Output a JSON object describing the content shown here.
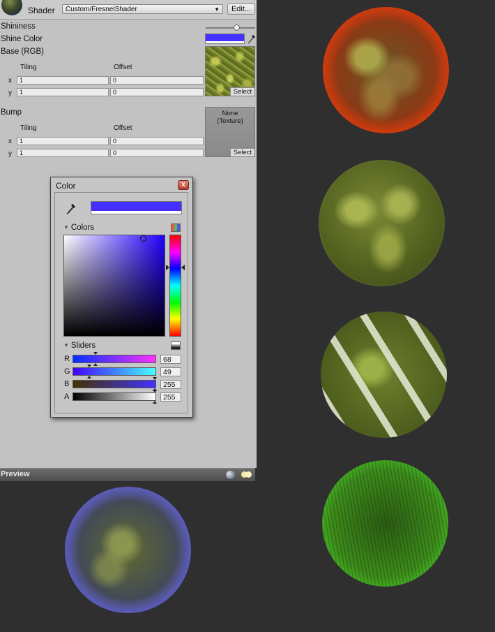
{
  "inspector": {
    "shader_label": "Shader",
    "shader_value": "Custom/FresnelShader",
    "edit_label": "Edit...",
    "props": {
      "shininess": "Shininess",
      "shine_color": "Shine Color",
      "shine_color_hex": "#4431ff",
      "base": "Base (RGB)",
      "bump": "Bump"
    },
    "base": {
      "tiling": "Tiling",
      "offset": "Offset",
      "x_label": "x",
      "y_label": "y",
      "tiling_x": "1",
      "tiling_y": "1",
      "offset_x": "0",
      "offset_y": "0",
      "select": "Select"
    },
    "bump": {
      "tiling": "Tiling",
      "offset": "Offset",
      "x_label": "x",
      "y_label": "y",
      "tiling_x": "1",
      "tiling_y": "1",
      "offset_x": "0",
      "offset_y": "0",
      "none_line1": "None",
      "none_line2": "(Texture)",
      "select": "Select"
    },
    "shininess_value": 0.62
  },
  "preview": {
    "title": "Preview"
  },
  "color_dialog": {
    "title": "Color",
    "close": "x",
    "colors_section": "Colors",
    "sliders_section": "Sliders",
    "channels": [
      {
        "label": "R",
        "value": "68"
      },
      {
        "label": "G",
        "value": "49"
      },
      {
        "label": "B",
        "value": "255"
      },
      {
        "label": "A",
        "value": "255"
      }
    ],
    "current_color": "#4431ff"
  },
  "spheres": [
    "fresnel-red",
    "diffuse",
    "specular",
    "green",
    "fresnel-blue"
  ]
}
